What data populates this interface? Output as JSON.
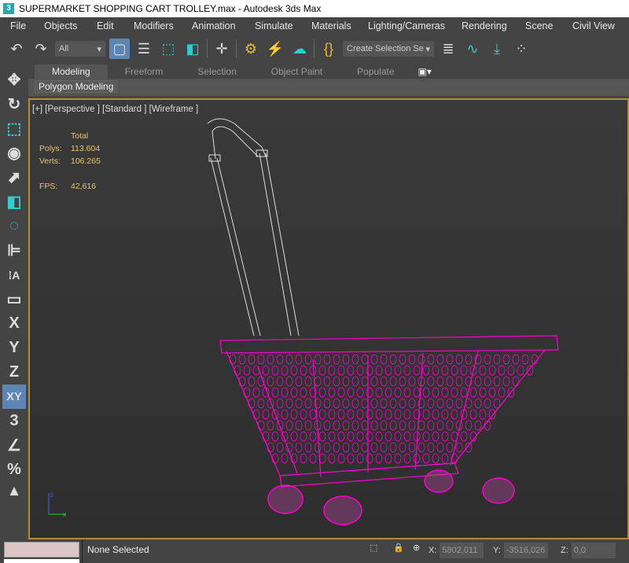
{
  "window": {
    "title": "SUPERMARKET SHOPPING CART TROLLEY.max - Autodesk 3ds Max",
    "icon_text": "3"
  },
  "menu": [
    "File",
    "Objects",
    "Edit",
    "Modifiers",
    "Animation",
    "Simulate",
    "Materials",
    "Lighting/Cameras",
    "Rendering",
    "Scene",
    "Civil View"
  ],
  "toolbar": {
    "filter_value": "All",
    "selection_set_placeholder": "Create Selection Se"
  },
  "ribbon": {
    "tabs": [
      "Modeling",
      "Freeform",
      "Selection",
      "Object Paint",
      "Populate"
    ],
    "active": "Modeling",
    "panel": "Polygon Modeling"
  },
  "left_tools": {
    "x": "X",
    "y": "Y",
    "z": "Z",
    "xy": "XY"
  },
  "viewport": {
    "label": "[+] [Perspective ] [Standard ] [Wireframe ]",
    "stats": {
      "header": "Total",
      "polys_label": "Polys:",
      "polys": "113.604",
      "verts_label": "Verts:",
      "verts": "106.265",
      "fps_label": "FPS:",
      "fps": "42,616"
    },
    "wire_color": "#ff00cc"
  },
  "status": {
    "selection": "None Selected",
    "x_label": "X:",
    "x": "5802,011",
    "y_label": "Y:",
    "y": "-3516,026",
    "z_label": "Z:",
    "z": "0,0"
  }
}
